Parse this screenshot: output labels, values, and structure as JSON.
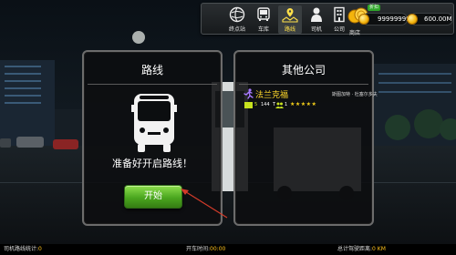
{
  "nav": {
    "items": [
      {
        "label": "终点站",
        "icon": "destination-globe-icon"
      },
      {
        "label": "车库",
        "icon": "bus-garage-icon"
      },
      {
        "label": "路线",
        "icon": "route-map-icon"
      },
      {
        "label": "司机",
        "icon": "driver-person-icon"
      },
      {
        "label": "公司",
        "icon": "company-building-icon"
      },
      {
        "label": "商店",
        "icon": "shop-coins-icon"
      }
    ],
    "active": "路线",
    "shop_badge": "折扣",
    "coins": "99999999",
    "money": "600.00M"
  },
  "route_panel": {
    "title": "路线",
    "message": "准备好开启路线！",
    "start_label": "开始"
  },
  "companies_panel": {
    "title": "其他公司",
    "company": {
      "name": "法兰克福",
      "location": "斯图加特 · 杜塞尔多夫",
      "level": "5",
      "buses": "144",
      "buses_unit": "T",
      "drivers": "1",
      "rating": 5
    }
  },
  "status_bar": {
    "driver_routes_label": "司机路线统计:",
    "driver_routes_value": "0",
    "drive_time_label": "开车时间:",
    "drive_time_value": "00:00",
    "total_distance_label": "总计驾驶距离:",
    "total_distance_value": "0 KM"
  },
  "colors": {
    "accent_yellow": "#ffd82a",
    "start_green": "#4aa61f",
    "level_green": "#c7e21f"
  }
}
